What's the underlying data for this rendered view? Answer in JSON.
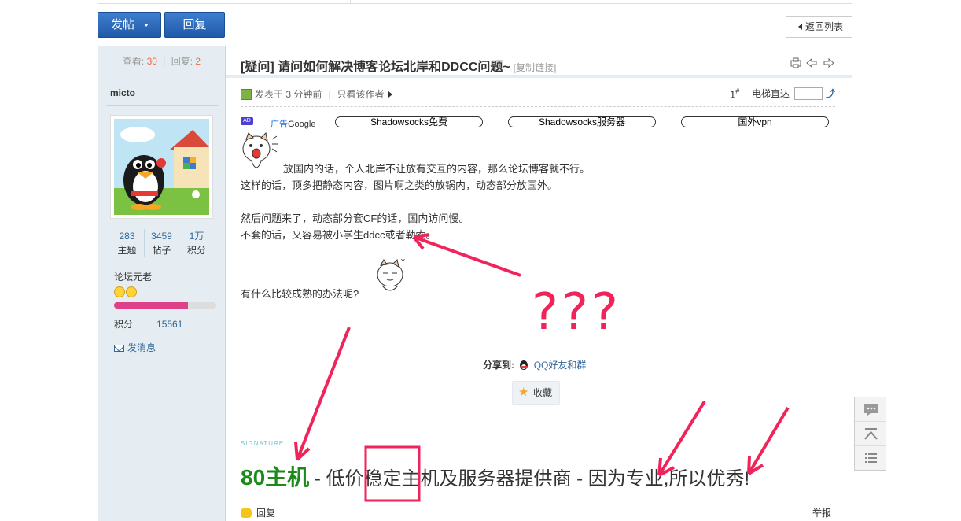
{
  "toolbar": {
    "post_label": "发帖",
    "reply_label": "回复",
    "back_label": "返回列表"
  },
  "side": {
    "views_label": "查看:",
    "views_count": "30",
    "replies_label": "回复:",
    "replies_count": "2",
    "author": "micto",
    "stats": [
      {
        "value": "283",
        "label": "主题"
      },
      {
        "value": "3459",
        "label": "帖子"
      },
      {
        "value": "1万",
        "label": "积分"
      }
    ],
    "rank": "论坛元老",
    "rank_progress": 0.72,
    "credit_label": "积分",
    "credit_value": "15561",
    "message_label": "发消息"
  },
  "post": {
    "title": "[疑问] 请问如何解决博客论坛北岸和DDCC问题~",
    "copy_link": "[复制链接]",
    "posted": "发表于 3 分钟前",
    "only_author": "只看该作者",
    "floor": "1",
    "floor_sup": "#",
    "jump_label": "电梯直达",
    "ad_badge": "AD",
    "ad_label": "广告",
    "ad_provider": "Google",
    "ad_links": [
      "Shadowsocks免费",
      "Shadowsocks服务器",
      "国外vpn"
    ],
    "paragraphs": [
      "放国内的话，个人北岸不让放有交互的内容，那么论坛博客就不行。",
      "这样的话，顶多把静态内容，图片啊之类的放锅内，动态部分放国外。",
      "",
      "然后问题来了，动态部分套CF的话，国内访问慢。",
      "不套的话，又容易被小学生ddcc或者勒索。"
    ],
    "question": "有什么比较成熟的办法呢?",
    "share_label": "分享到:",
    "share_qq": "QQ好友和群",
    "fav_label": "收藏",
    "signature_label": "SIGNATURE",
    "signature_brand": "80主机",
    "signature_text": " - 低价稳定主机及服务器提供商 - 因为专业,所以优秀!",
    "reply_label": "回复",
    "report_label": "举报"
  },
  "annotation": {
    "qmarks": "???",
    "color": "#f0245a"
  }
}
